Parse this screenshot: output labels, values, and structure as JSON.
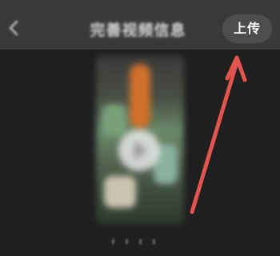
{
  "header": {
    "back_icon": "chevron-left-icon",
    "title": "完善视频信息",
    "upload_label": "上传"
  },
  "preview": {
    "play_icon": "play-icon"
  },
  "annotation": {
    "type": "arrow",
    "color": "#e2554f",
    "points_to": "upload-button"
  }
}
